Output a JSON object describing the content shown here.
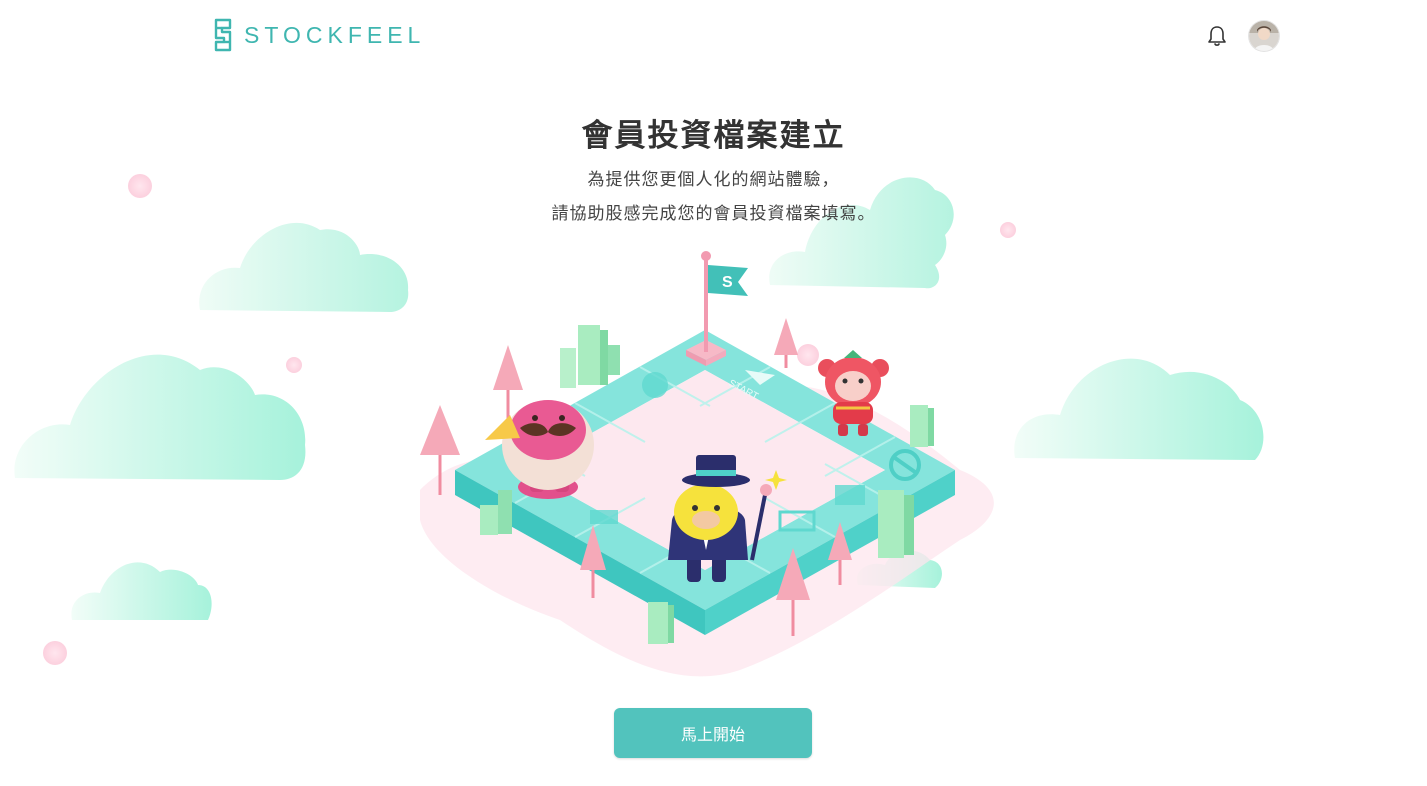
{
  "header": {
    "brand": "STOCKFEEL",
    "logo_icon": "stockfeel-s-logo",
    "notification_icon": "bell-icon",
    "avatar_icon": "user-avatar"
  },
  "main": {
    "title": "會員投資檔案建立",
    "subtitle_line1": "為提供您更個人化的網站體驗，",
    "subtitle_line2": "請協助股感完成您的會員投資檔案填寫。",
    "illustration": {
      "flag_label": "S",
      "tile_label": "START"
    },
    "start_button": "馬上開始"
  },
  "colors": {
    "brand_teal": "#3fb6b0",
    "button_teal": "#52c3bd",
    "cloud_mint": "#a9f0da",
    "tile_cyan": "#7fe0d8",
    "tree_pink": "#f5a9b8"
  }
}
